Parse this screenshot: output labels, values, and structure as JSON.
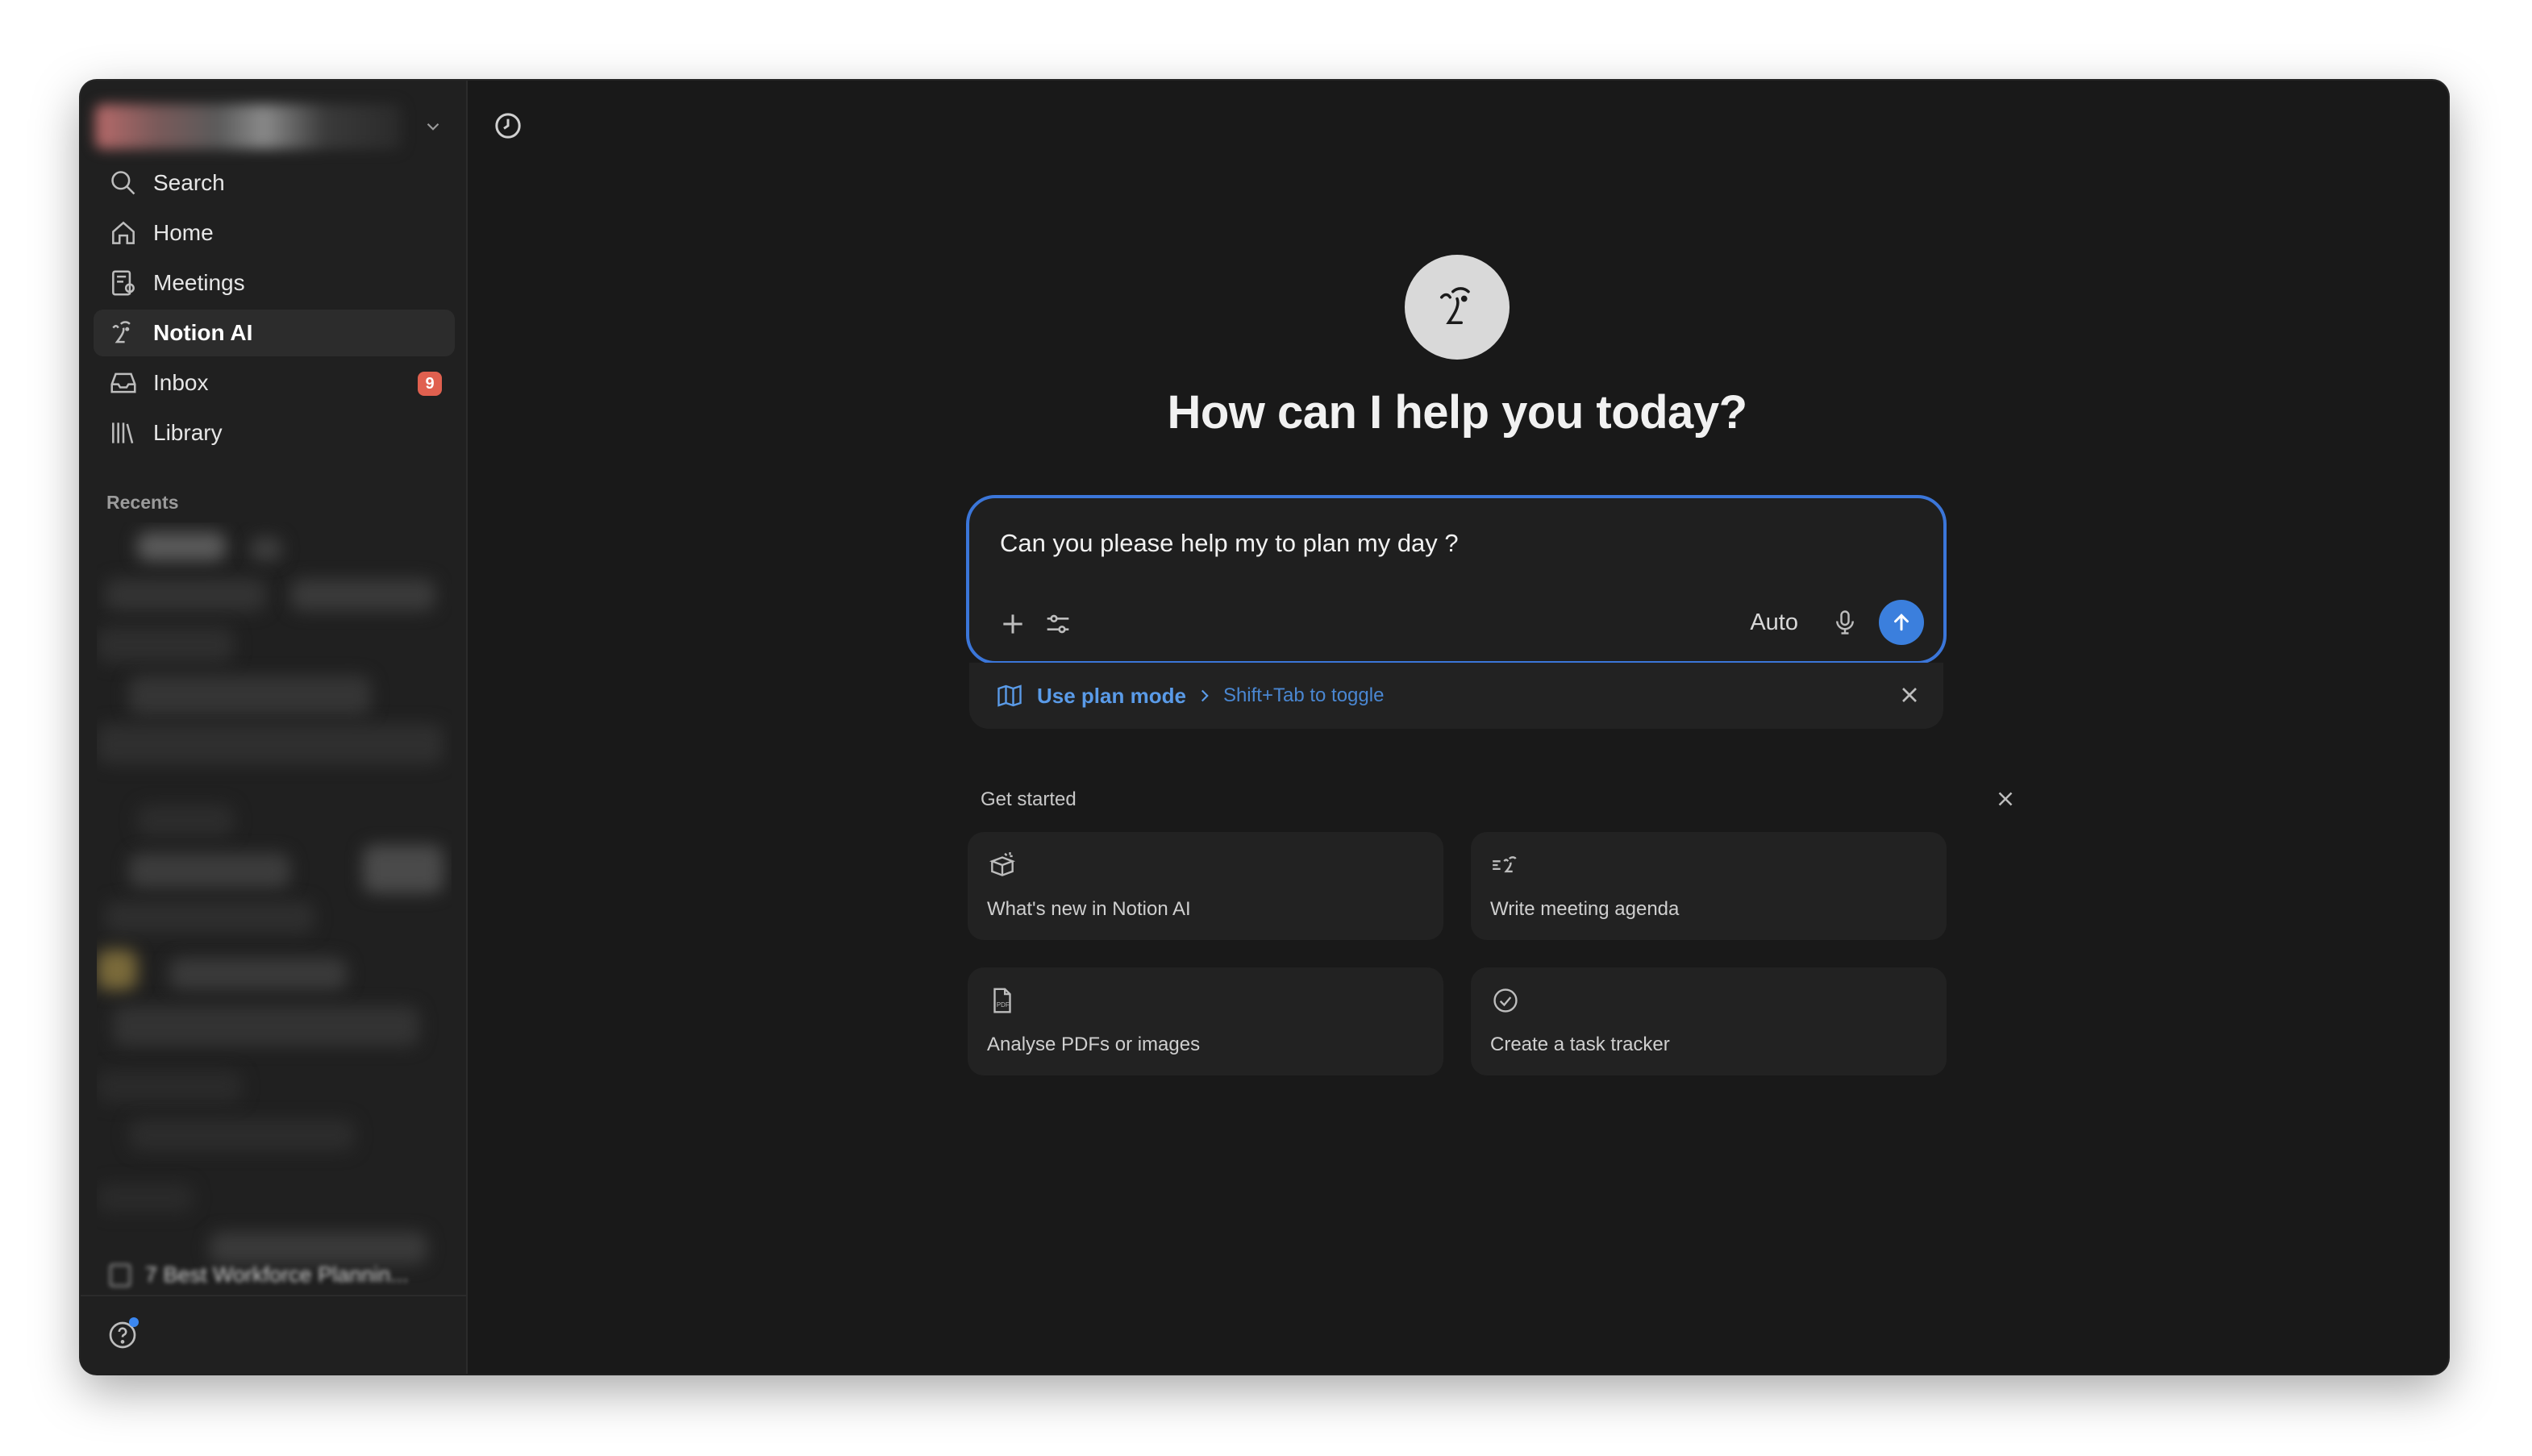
{
  "sidebar": {
    "nav": [
      {
        "label": "Search",
        "icon": "search-icon"
      },
      {
        "label": "Home",
        "icon": "home-icon"
      },
      {
        "label": "Meetings",
        "icon": "meetings-icon"
      },
      {
        "label": "Notion AI",
        "icon": "notion-ai-icon",
        "active": true
      },
      {
        "label": "Inbox",
        "icon": "inbox-icon",
        "badge": "9"
      },
      {
        "label": "Library",
        "icon": "library-icon"
      }
    ],
    "recents_label": "Recents",
    "last_recent": "7 Best Workforce Plannin..."
  },
  "main": {
    "heading": "How can I help you today?",
    "composer": {
      "text": "Can you please help my to plan my day ?",
      "mode": "Auto"
    },
    "plan_mode": {
      "label": "Use plan mode",
      "hint": "Shift+Tab to toggle"
    },
    "get_started": {
      "label": "Get started",
      "cards": [
        {
          "label": "What's new in Notion AI",
          "icon": "gift-box-icon"
        },
        {
          "label": "Write meeting agenda",
          "icon": "agenda-icon"
        },
        {
          "label": "Analyse PDFs or images",
          "icon": "pdf-icon"
        },
        {
          "label": "Create a task tracker",
          "icon": "check-circle-icon"
        }
      ]
    }
  },
  "colors": {
    "accent": "#3b7fdd",
    "badge": "#e0604f",
    "background": "#191919",
    "sidebar": "#202020"
  }
}
